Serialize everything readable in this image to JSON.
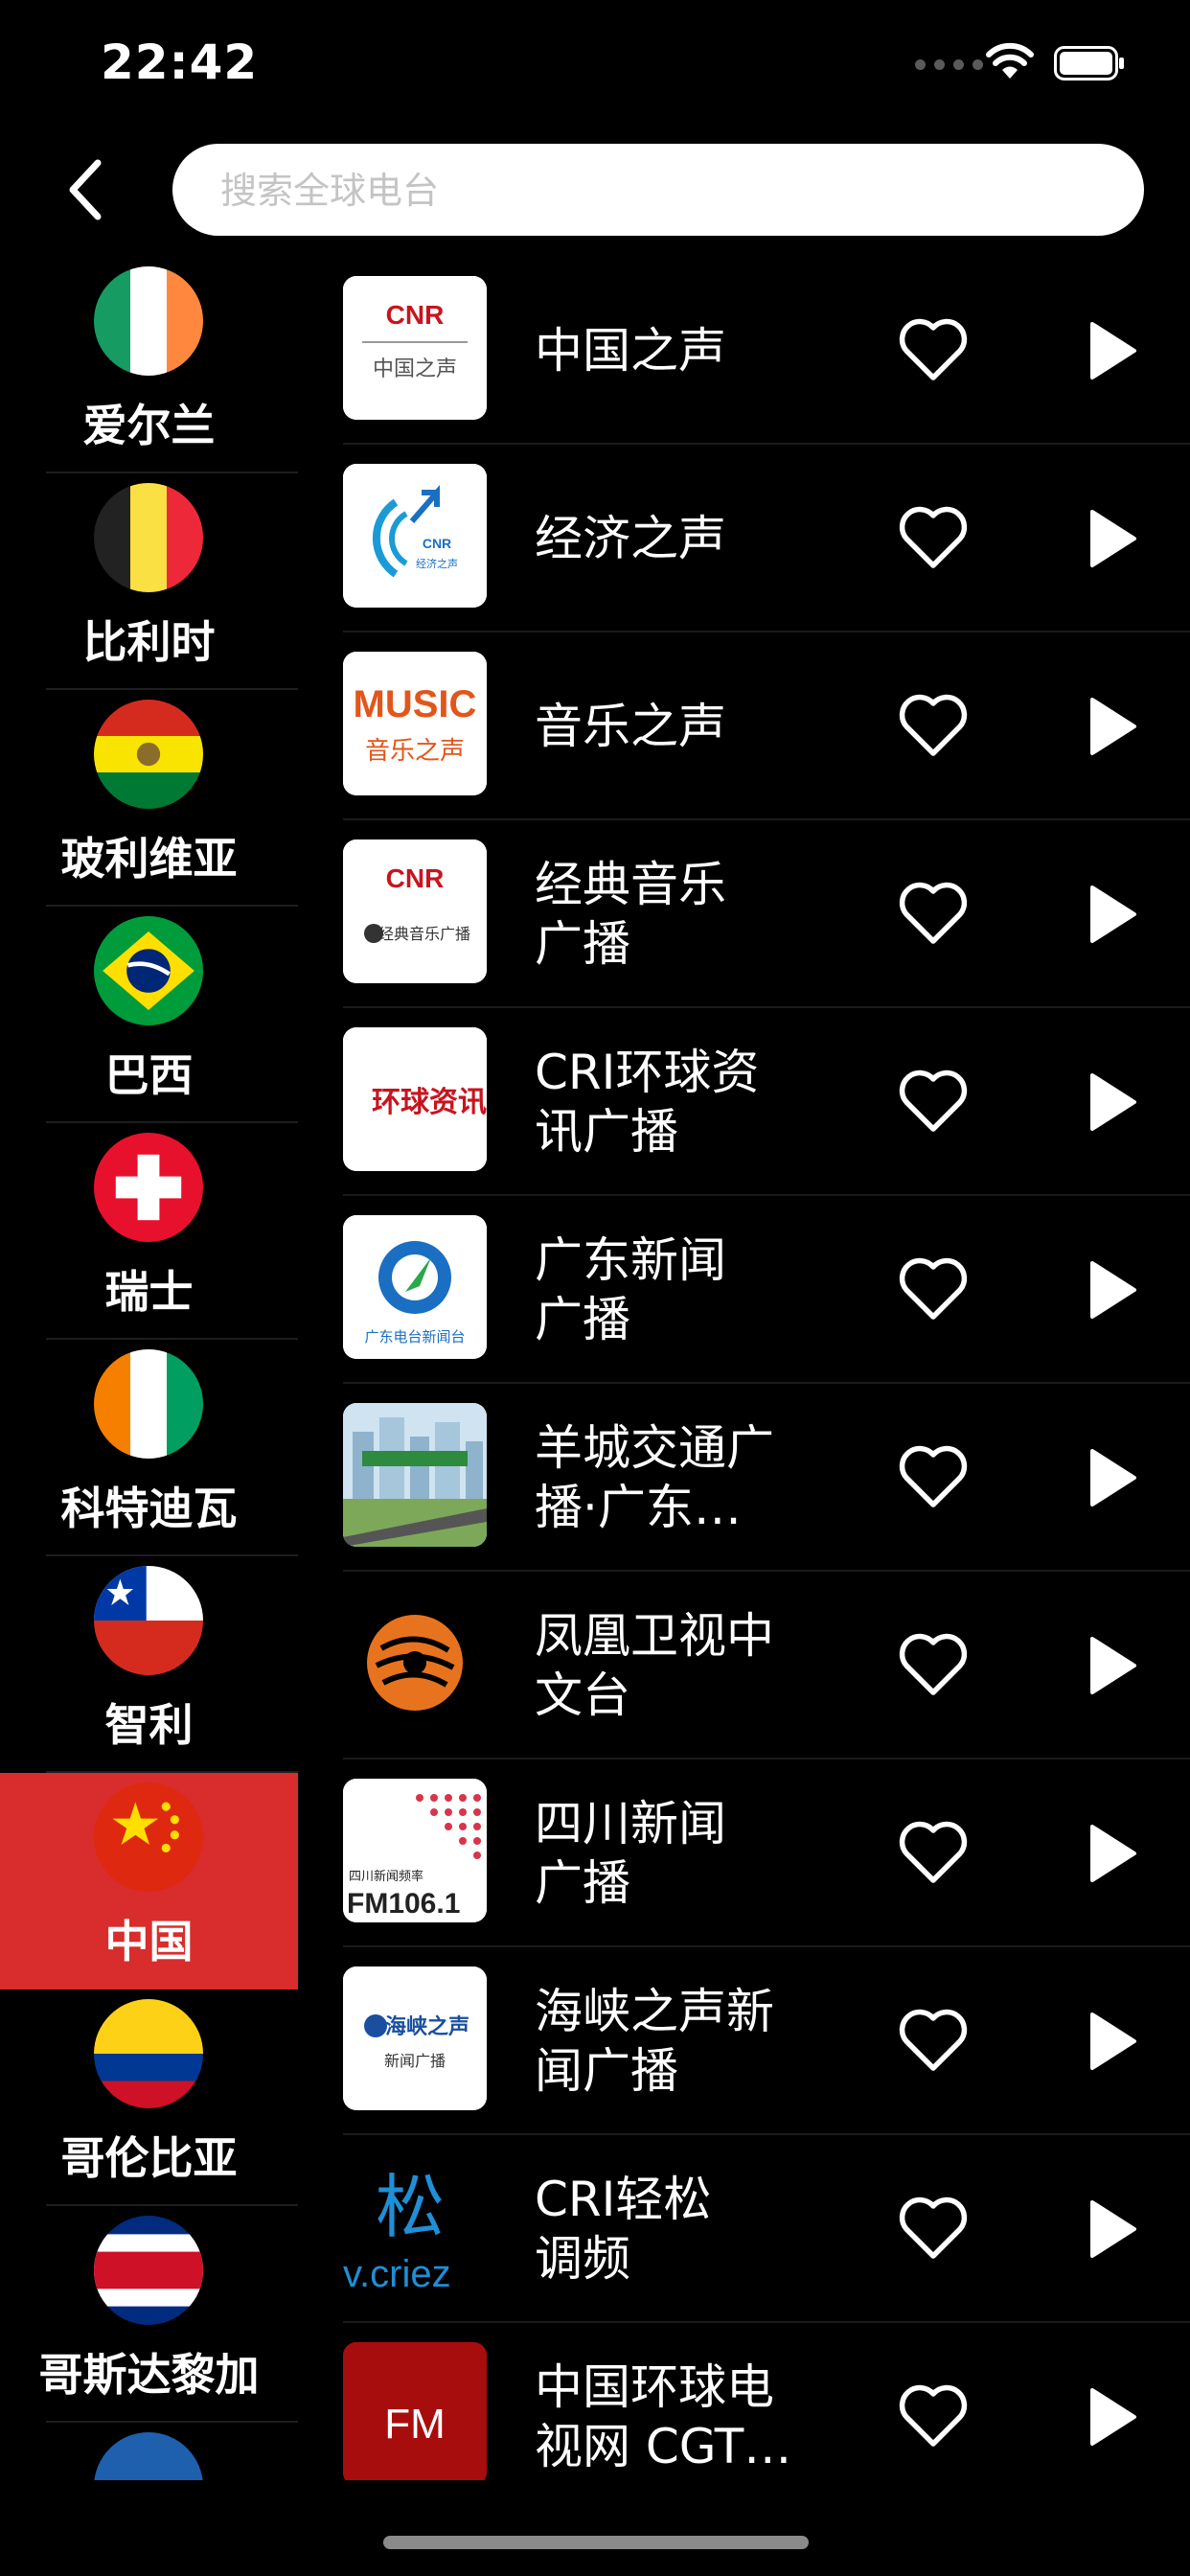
{
  "status_bar": {
    "time": "22:42",
    "icons": [
      "cellular-signal-icon",
      "wifi-icon",
      "battery-icon"
    ]
  },
  "search": {
    "placeholder": "搜索全球电台"
  },
  "countries": [
    {
      "name": "爱尔兰",
      "flag": "ireland-flag-icon"
    },
    {
      "name": "比利时",
      "flag": "belgium-flag-icon"
    },
    {
      "name": "玻利维亚",
      "flag": "bolivia-flag-icon"
    },
    {
      "name": "巴西",
      "flag": "brazil-flag-icon"
    },
    {
      "name": "瑞士",
      "flag": "switzerland-flag-icon"
    },
    {
      "name": "科特迪瓦",
      "flag": "ivory-coast-flag-icon"
    },
    {
      "name": "智利",
      "flag": "chile-flag-icon"
    },
    {
      "name": "中国",
      "flag": "china-flag-icon",
      "selected": true
    },
    {
      "name": "哥伦比亚",
      "flag": "colombia-flag-icon"
    },
    {
      "name": "哥斯达黎加",
      "flag": "costa-rica-flag-icon"
    },
    {
      "name": "",
      "flag": "next-country-flag-icon"
    }
  ],
  "stations": [
    {
      "name": "中国之声",
      "logo_text": [
        "CNR",
        "中国之声"
      ]
    },
    {
      "name": "经济之声",
      "logo_text": [
        "CNR",
        "经济之声"
      ]
    },
    {
      "name": "音乐之声",
      "logo_text": [
        "MUSIC",
        "音乐之声"
      ]
    },
    {
      "name": "经典音乐\n广播",
      "logo_text": [
        "CNR",
        "经典音乐广播"
      ]
    },
    {
      "name": "CRI环球资\n讯广播",
      "logo_text": [
        "环球资讯"
      ]
    },
    {
      "name": "广东新闻\n广播",
      "logo_text": [
        "广东电台新闻台"
      ]
    },
    {
      "name": "羊城交通广\n播·广东…",
      "logo_text": []
    },
    {
      "name": "凤凰卫视中\n文台",
      "logo_text": []
    },
    {
      "name": "四川新闻\n广播",
      "logo_text": [
        "四川新闻频率",
        "FM106.1"
      ]
    },
    {
      "name": "海峡之声新\n闻广播",
      "logo_text": [
        "海峡之声",
        "新闻广播"
      ]
    },
    {
      "name": "CRI轻松\n调频",
      "logo_text": [
        "松",
        "v.criez"
      ]
    },
    {
      "name": "中国环球电\n视网 CGT…",
      "logo_text": [
        "FM"
      ]
    }
  ],
  "colors": {
    "selected_bg": "#d92c2c",
    "background": "#000000",
    "text": "#ffffff"
  }
}
